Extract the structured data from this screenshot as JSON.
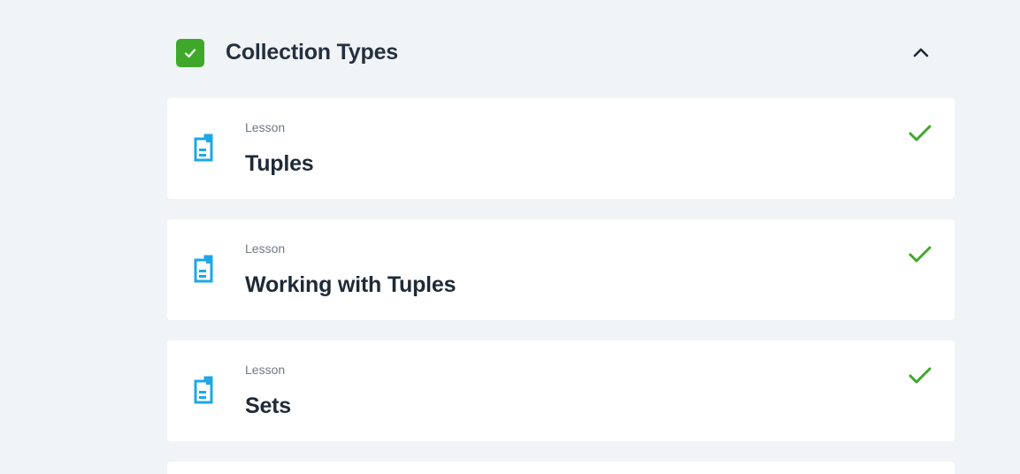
{
  "section": {
    "title": "Collection Types",
    "completed": true,
    "expanded": true,
    "accent_color": "#3fa82a",
    "completed_icon": "check-icon",
    "collapse_icon": "chevron-up-icon"
  },
  "lessons": [
    {
      "kicker": "Lesson",
      "title": "Tuples",
      "icon": "document-icon",
      "status": "completed"
    },
    {
      "kicker": "Lesson",
      "title": "Working with Tuples",
      "icon": "document-icon",
      "status": "completed"
    },
    {
      "kicker": "Lesson",
      "title": "Sets",
      "icon": "document-icon",
      "status": "completed"
    }
  ],
  "colors": {
    "background": "#f1f4f7",
    "card": "#ffffff",
    "icon_blue": "#1ea7e7",
    "text_primary": "#1f2a37",
    "text_secondary": "#707985"
  }
}
